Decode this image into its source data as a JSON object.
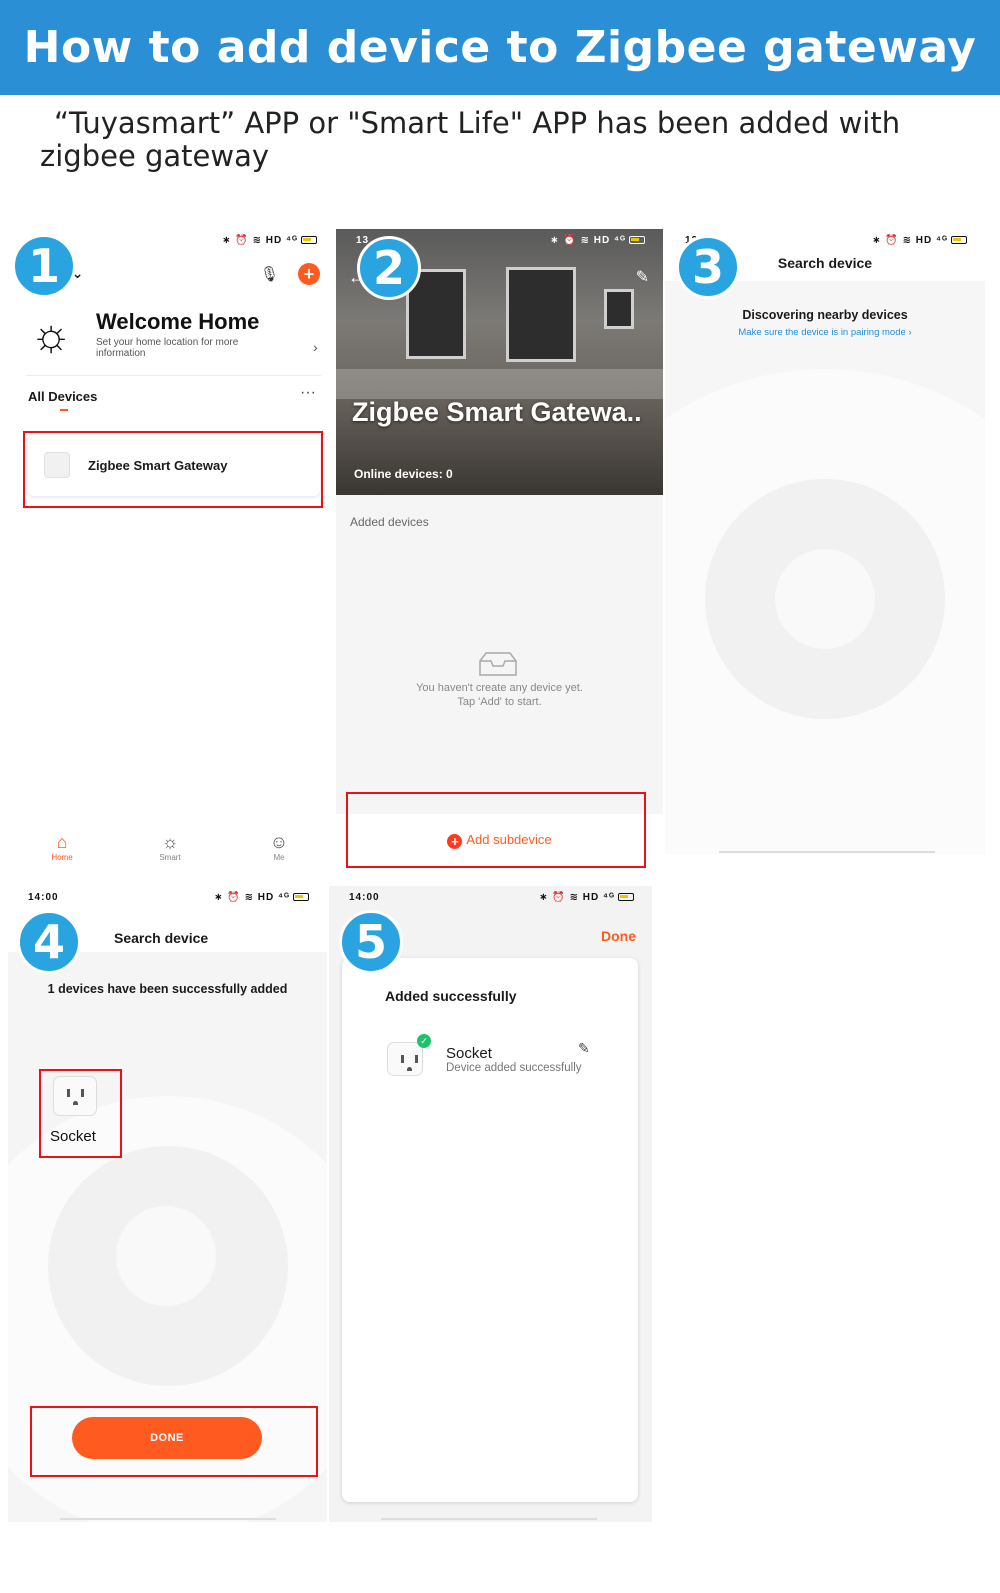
{
  "banner": {
    "title": "How to add device to Zigbee gateway"
  },
  "intro": {
    "text_line1": "“Tuyasmart”  APP or \"Smart Life\" APP has been added with",
    "text_line2": "zigbee gateway"
  },
  "colors": {
    "banner": "#2b8fd6",
    "step_badge": "#2aa4e0",
    "accent": "#ff5a1f",
    "highlight_box": "#e11111",
    "success": "#1fc46a",
    "link": "#1f8fe0"
  },
  "steps": [
    "1",
    "2",
    "3",
    "4",
    "5"
  ],
  "screen1": {
    "status_icons": "∗ ⏰ ≋ HD ⁴ᴳ",
    "house_name": "..",
    "title": "Welcome Home",
    "subtitle": "Set your home location for more information",
    "section": "All Devices",
    "device": "Zigbee Smart Gateway",
    "tabs": [
      "Home",
      "Smart",
      "Me"
    ],
    "icons": [
      "sun-icon",
      "mic-icon",
      "plus-icon",
      "more-icon",
      "home-icon",
      "smart-icon",
      "me-icon"
    ]
  },
  "screen2": {
    "status_time": "13",
    "status_icons": "∗ ⏰ ≋ HD ⁴ᴳ",
    "title": "Zigbee Smart Gatewa..",
    "online": "Online devices: 0",
    "section": "Added devices",
    "empty_line1": "You haven't create any device yet.",
    "empty_line2": "Tap 'Add' to start.",
    "add_button": "Add subdevice"
  },
  "screen3": {
    "status_time": "13:51",
    "status_icons": "∗ ⏰ ≋ HD ⁴ᴳ",
    "title": "Search device",
    "discovering": "Discovering nearby devices",
    "hint": "Make sure the device is in pairing mode ›"
  },
  "screen4": {
    "status_time": "14:00",
    "status_icons": "∗ ⏰ ≋ HD ⁴ᴳ",
    "title": "Search device",
    "message": "1 devices have been successfully added",
    "device": "Socket",
    "done_button": "DONE"
  },
  "screen5": {
    "status_time": "14:00",
    "status_icons": "∗ ⏰ ≋ HD ⁴ᴳ",
    "done_link": "Done",
    "heading": "Added successfully",
    "device": "Socket",
    "device_status": "Device added successfully"
  }
}
